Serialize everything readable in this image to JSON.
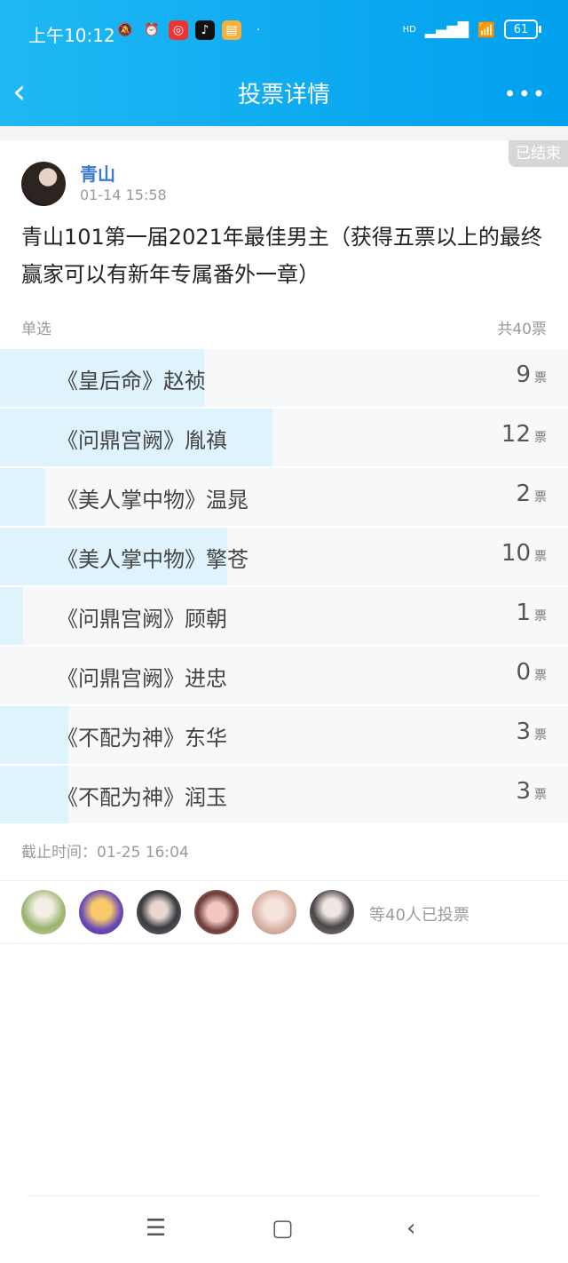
{
  "status_bar": {
    "time": "上午10:12",
    "battery": "61",
    "hd": "HD"
  },
  "nav": {
    "back": "‹",
    "title": "投票详情",
    "more": "•••"
  },
  "badge": "已结束",
  "post": {
    "author": "青山",
    "time": "01-14 15:58",
    "title": "青山101第一届2021年最佳男主（获得五票以上的最终赢家可以有新年专属番外一章）"
  },
  "meta": {
    "mode": "单选",
    "total": "共40票"
  },
  "options": [
    {
      "label": "《皇后命》赵祯",
      "count": "9",
      "unit": "票",
      "share": 0.225
    },
    {
      "label": "《问鼎宫阙》胤禛",
      "count": "12",
      "unit": "票",
      "share": 0.3
    },
    {
      "label": "《美人掌中物》温晁",
      "count": "2",
      "unit": "票",
      "share": 0.05
    },
    {
      "label": "《美人掌中物》擎苍",
      "count": "10",
      "unit": "票",
      "share": 0.25
    },
    {
      "label": "《问鼎宫阙》顾朝",
      "count": "1",
      "unit": "票",
      "share": 0.025
    },
    {
      "label": "《问鼎宫阙》进忠",
      "count": "0",
      "unit": "票",
      "share": 0
    },
    {
      "label": "《不配为神》东华",
      "count": "3",
      "unit": "票",
      "share": 0.075
    },
    {
      "label": "《不配为神》润玉",
      "count": "3",
      "unit": "票",
      "share": 0.075
    }
  ],
  "deadline": "截止时间：01-25 16:04",
  "voters": {
    "text": "等40人已投票"
  },
  "bottom_nav": {
    "menu": "☰",
    "home": "▢",
    "back": "‹"
  }
}
